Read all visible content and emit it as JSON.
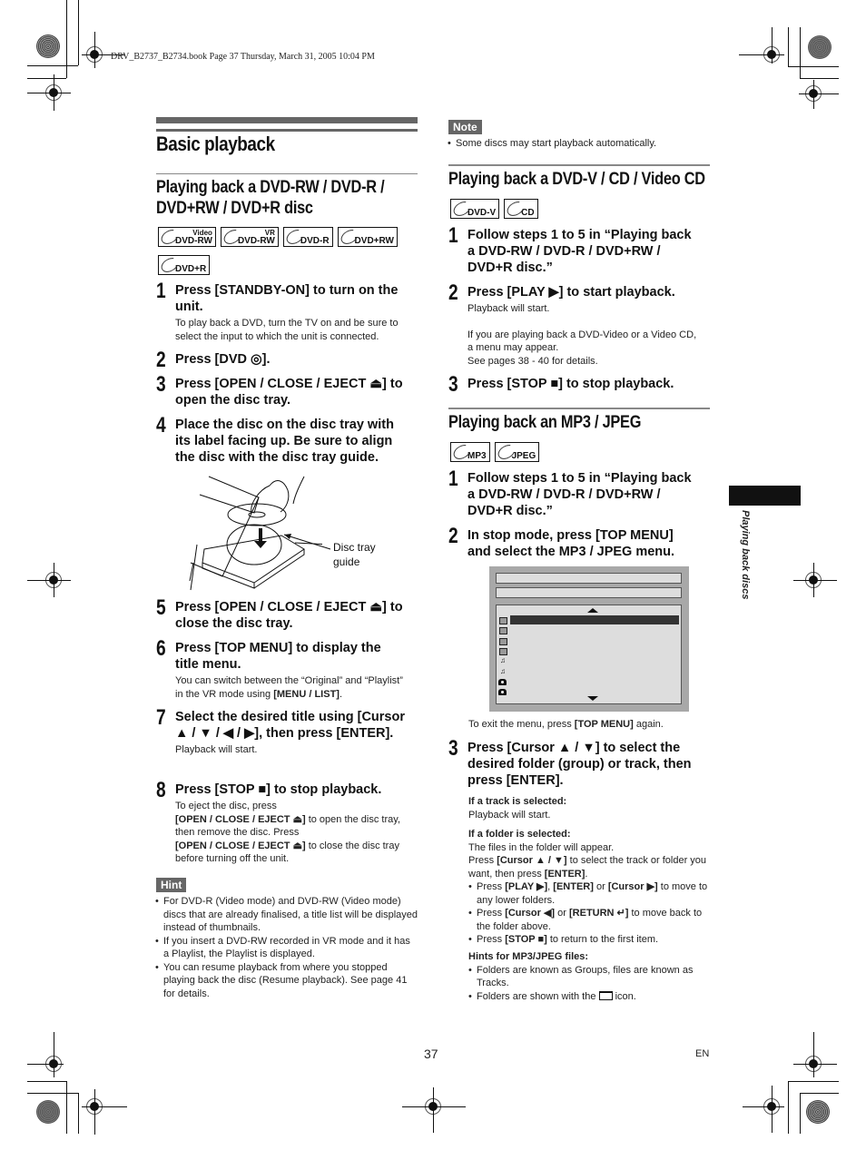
{
  "print_header": "DRV_B2737_B2734.book  Page 37  Thursday, March 31, 2005  10:04 PM",
  "page_title": "Basic playback",
  "side_tab": "Playing back discs",
  "footer": {
    "page_number": "37",
    "language": "EN"
  },
  "left": {
    "section_title": [
      "Playing back a DVD-RW / DVD-R /",
      "DVD+RW / DVD+R disc"
    ],
    "badges": [
      {
        "label": "DVD-RW",
        "sup": "Video"
      },
      {
        "label": "DVD-RW",
        "sup": "VR"
      },
      {
        "label": "DVD-R",
        "sup": ""
      },
      {
        "label": "DVD+RW",
        "sup": ""
      },
      {
        "label": "DVD+R",
        "sup": ""
      }
    ],
    "steps": [
      {
        "num": "1",
        "head": "Press [STANDBY-ON] to turn on the unit.",
        "body": "To play back a DVD, turn the TV on and be sure to select the input to which the unit is connected."
      },
      {
        "num": "2",
        "head": "Press [DVD ◎].",
        "body": ""
      },
      {
        "num": "3",
        "head": "Press [OPEN / CLOSE / EJECT ⏏] to open the disc tray.",
        "body": ""
      },
      {
        "num": "4",
        "head": "Place the disc on the disc tray with its label facing up. Be sure to align the disc with the disc tray guide.",
        "body": ""
      },
      {
        "num": "5",
        "head": "Press [OPEN / CLOSE / EJECT ⏏] to close the disc tray.",
        "body": ""
      },
      {
        "num": "6",
        "head": "Press [TOP MENU] to display the title menu.",
        "body_pre": "You can switch between the “Original” and “Playlist” in the VR mode using ",
        "body_bold": "[MENU / LIST]",
        "body_post": "."
      },
      {
        "num": "7",
        "head": "Select the desired title using [Cursor ▲ / ▼ / ◀ / ▶], then press [ENTER].",
        "body": "Playback will start."
      },
      {
        "num": "8",
        "head": "Press [STOP ■] to stop playback.",
        "body_1": "To eject the disc, press",
        "body_b1": "[OPEN / CLOSE / EJECT ⏏]",
        "body_2": " to open the disc tray, then remove the disc. Press",
        "body_b2": "[OPEN / CLOSE / EJECT ⏏]",
        "body_3": " to close the disc tray before turning off the unit."
      }
    ],
    "illustration_callout": [
      "Disc tray",
      "guide"
    ],
    "hint": {
      "label": "Hint",
      "items": [
        "For DVD-R (Video mode) and DVD-RW (Video mode) discs that are already finalised, a title list will be displayed instead of thumbnails.",
        "If you insert a DVD-RW recorded in VR mode and it has a Playlist, the Playlist is displayed.",
        "You can resume playback from where you stopped playing back the disc (Resume playback). See page 41 for details."
      ]
    }
  },
  "right": {
    "note": {
      "label": "Note",
      "items": [
        "Some discs may start playback automatically."
      ]
    },
    "dvdv": {
      "title": "Playing back a DVD-V / CD / Video CD",
      "badges": [
        {
          "label": "DVD-V"
        },
        {
          "label": "CD"
        }
      ],
      "steps": [
        {
          "num": "1",
          "head": "Follow steps 1 to 5 in “Playing back a DVD-RW / DVD-R / DVD+RW / DVD+R disc.”"
        },
        {
          "num": "2",
          "head": "Press [PLAY ▶] to start playback.",
          "body_1": "Playback will start.",
          "body_2": "If you are playing back a DVD-Video or a Video CD, a menu may appear.",
          "body_3": "See pages 38 - 40 for details."
        },
        {
          "num": "3",
          "head": "Press [STOP ■] to stop playback."
        }
      ]
    },
    "mp3": {
      "title": "Playing back an MP3 / JPEG",
      "badges": [
        {
          "label": "MP3"
        },
        {
          "label": "JPEG"
        }
      ],
      "steps": [
        {
          "num": "1",
          "head": "Follow steps 1 to 5 in “Playing back a DVD-RW / DVD-R / DVD+RW / DVD+R disc.”"
        },
        {
          "num": "2",
          "head": "In stop mode, press [TOP MENU] and select the MP3 / JPEG menu.",
          "exit_pre": "To exit the menu, press ",
          "exit_bold": "[TOP MENU]",
          "exit_post": " again."
        },
        {
          "num": "3",
          "head": "Press [Cursor ▲ / ▼] to select the desired folder (group) or track, then press [ENTER]."
        }
      ],
      "menu_rows": [
        {
          "icon": "folder",
          "selected": true
        },
        {
          "icon": "folder",
          "selected": false
        },
        {
          "icon": "folder",
          "selected": false
        },
        {
          "icon": "folder",
          "selected": false
        },
        {
          "icon": "music",
          "selected": false
        },
        {
          "icon": "music",
          "selected": false
        },
        {
          "icon": "camera",
          "selected": false
        },
        {
          "icon": "camera",
          "selected": false
        }
      ],
      "track_selected": {
        "label": "If a track is selected:",
        "text": "Playback will start."
      },
      "folder_selected": {
        "label": "If a folder is selected:",
        "line1": "The files in the folder will appear.",
        "line2_pre": "Press ",
        "line2_b1": "[Cursor ▲ / ▼]",
        "line2_mid": " to select the track or folder you want, then press ",
        "line2_b2": "[ENTER]",
        "line2_post": ".",
        "bullets": [
          {
            "pre": "Press ",
            "b1": "[PLAY ▶]",
            "m1": ", ",
            "b2": "[ENTER]",
            "m2": " or ",
            "b3": "[Cursor ▶]",
            "post": " to move to any lower folders."
          },
          {
            "pre": "Press ",
            "b1": "[Cursor ◀]",
            "m1": " or ",
            "b2": "[RETURN ↵]",
            "m2": "",
            "b3": "",
            "post": " to move back to the folder above."
          },
          {
            "pre": "Press ",
            "b1": "[STOP ■]",
            "m1": "",
            "b2": "",
            "m2": "",
            "b3": "",
            "post": " to return to the first item."
          }
        ]
      },
      "hints": {
        "label": "Hints for MP3/JPEG files:",
        "items": [
          "Folders are known as Groups, files are known as Tracks."
        ],
        "folder_icon_pre": "Folders are shown with the ",
        "folder_icon_post": " icon."
      }
    }
  }
}
